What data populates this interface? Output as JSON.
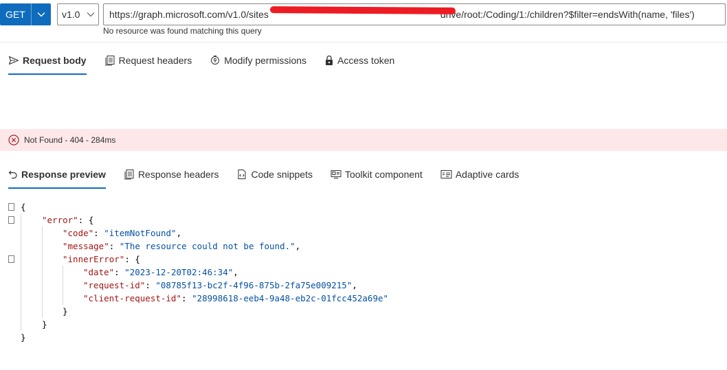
{
  "request": {
    "method": "GET",
    "version": "v1.0",
    "url_prefix": "https://graph.microsoft.com/v1.0/sites",
    "url_suffix": "drive/root:/Coding/1:/children?$filter=endsWith(name, 'files')",
    "hint": "No resource was found matching this query"
  },
  "request_tabs": [
    {
      "label": "Request body",
      "icon": "send-icon",
      "active": true
    },
    {
      "label": "Request headers",
      "icon": "headers-icon",
      "active": false
    },
    {
      "label": "Modify permissions",
      "icon": "permissions-icon",
      "active": false
    },
    {
      "label": "Access token",
      "icon": "lock-icon",
      "active": false
    }
  ],
  "status": {
    "text": "Not Found - 404 - 284ms",
    "color": "#a4262c",
    "background": "#fde7e9"
  },
  "response_tabs": [
    {
      "label": "Response preview",
      "icon": "undo-icon",
      "active": true
    },
    {
      "label": "Response headers",
      "icon": "headers-icon",
      "active": false
    },
    {
      "label": "Code snippets",
      "icon": "code-icon",
      "active": false
    },
    {
      "label": "Toolkit component",
      "icon": "toolkit-icon",
      "active": false
    },
    {
      "label": "Adaptive cards",
      "icon": "card-icon",
      "active": false
    }
  ],
  "response_json": {
    "l1": "{",
    "error_key": "\"error\"",
    "code_key": "\"code\"",
    "code_val": "\"itemNotFound\"",
    "message_key": "\"message\"",
    "message_val": "\"The resource could not be found.\"",
    "inner_key": "\"innerError\"",
    "date_key": "\"date\"",
    "date_val": "\"2023-12-20T02:46:34\"",
    "reqid_key": "\"request-id\"",
    "reqid_val": "\"08785f13-bc2f-4f96-875b-2fa75e009215\"",
    "creqid_key": "\"client-request-id\"",
    "creqid_val": "\"28998618-eeb4-9a48-eb2c-01fcc452a69e\"",
    "close_inner": "}",
    "close_error": "}",
    "close_root": "}"
  },
  "colors": {
    "accent": "#0f6cbd",
    "json_key": "#a31515",
    "json_string": "#0451a5"
  }
}
